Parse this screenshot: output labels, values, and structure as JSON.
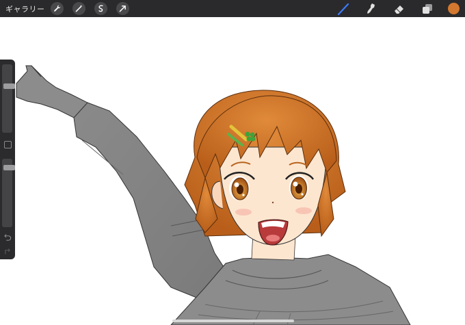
{
  "topbar": {
    "gallery_label": "ギャラリー",
    "tools_left": [
      {
        "icon": "wrench-icon"
      },
      {
        "icon": "magic-wand-icon"
      },
      {
        "icon": "selection-icon"
      },
      {
        "icon": "transform-arrow-icon"
      }
    ],
    "tools_right": [
      {
        "icon": "brush-icon",
        "active_color": "#3a7bff"
      },
      {
        "icon": "smudge-icon"
      },
      {
        "icon": "eraser-icon"
      },
      {
        "icon": "layers-icon"
      }
    ],
    "current_color": "#d2782f"
  },
  "sidebar": {
    "brush_size_level": 0.7,
    "opacity_level": 0.08
  },
  "colors": {
    "hair": "#d2782f",
    "sweater": "#8c8c8c",
    "skin": "#fde6cf",
    "ui_dark": "#2a2a2c"
  }
}
